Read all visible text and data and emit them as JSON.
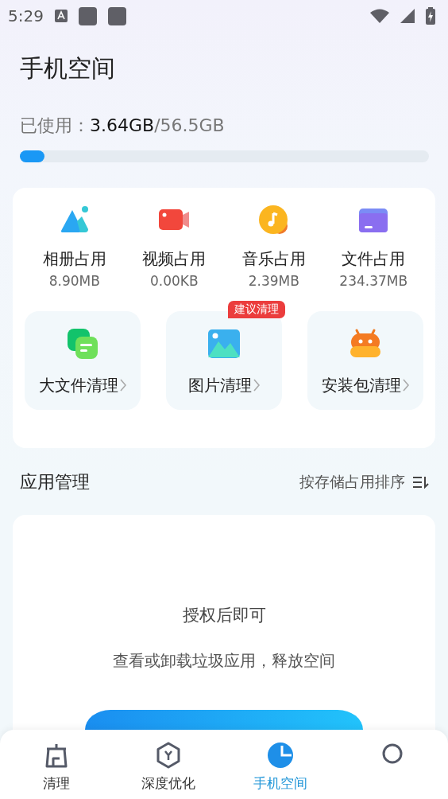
{
  "status_bar": {
    "time": "5:29"
  },
  "title": "手机空间",
  "storage": {
    "label": "已使用：",
    "used": "3.64GB",
    "total": "/56.5GB",
    "level": 0.06
  },
  "categories": [
    {
      "kind": "album",
      "label": "相册占用",
      "size": "8.90MB"
    },
    {
      "kind": "video",
      "label": "视频占用",
      "size": "0.00KB"
    },
    {
      "kind": "music",
      "label": "音乐占用",
      "size": "2.39MB"
    },
    {
      "kind": "file",
      "label": "文件占用",
      "size": "234.37MB"
    }
  ],
  "cleaners": [
    {
      "kind": "large_file",
      "label": "大文件清理"
    },
    {
      "kind": "image",
      "label": "图片清理",
      "badge": "建议清理"
    },
    {
      "kind": "apk",
      "label": "安装包清理"
    }
  ],
  "app_management": {
    "title": "应用管理",
    "sort": "按存储占用排序",
    "message": "授权后即可",
    "description": "查看或卸载垃圾应用，释放空间"
  },
  "tabs": [
    {
      "kind": "clean",
      "label": "清理",
      "selected": false
    },
    {
      "kind": "optimize",
      "label": "深度优化",
      "selected": false
    },
    {
      "kind": "space",
      "label": "手机空间",
      "selected": true
    },
    {
      "kind": "profile",
      "selected": false
    }
  ]
}
